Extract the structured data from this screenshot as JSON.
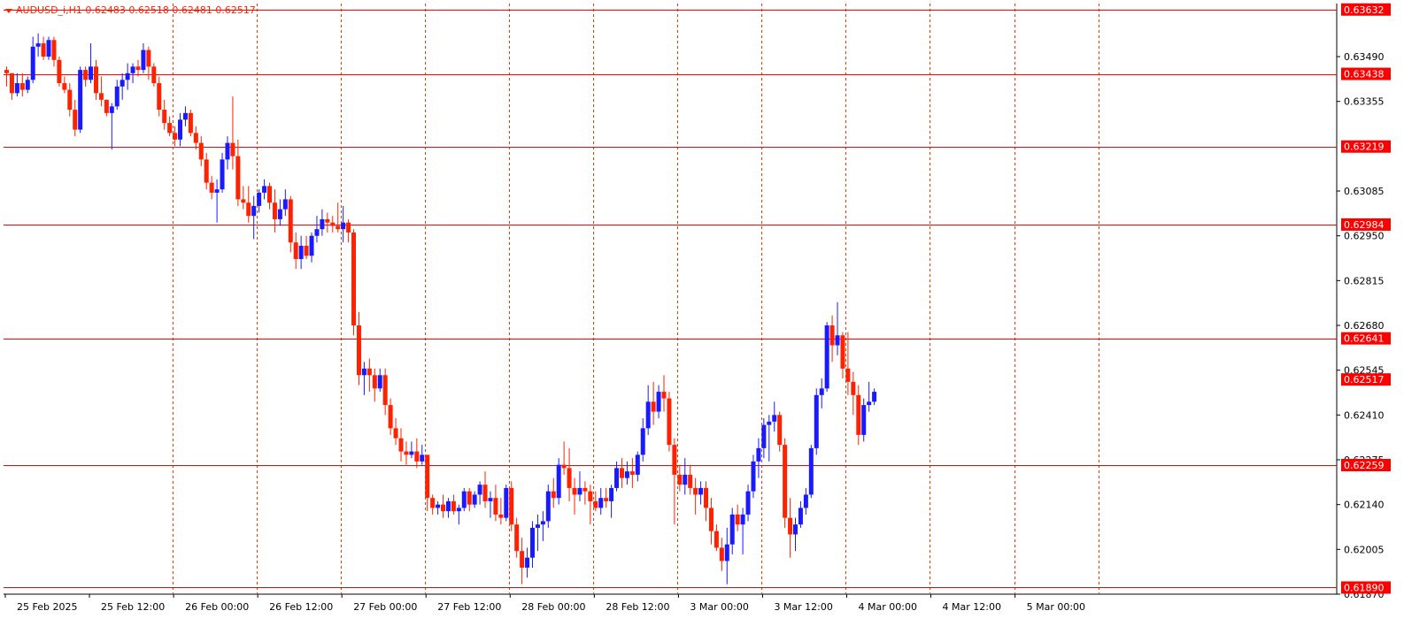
{
  "header": {
    "symbol_info": "AUDUSD_i,H1  0.62483 0.62518 0.62481 0.62517"
  },
  "colors": {
    "bull": "#1a1aff",
    "bear": "#ff2200",
    "hline": "#ff0000",
    "vgrid": "#ff3300",
    "axis": "#000000",
    "price_tag_bg": "#ff0000",
    "price_tag_text": "#ffffff"
  },
  "chart_data": {
    "type": "candlestick",
    "timeframe": "H1",
    "symbol": "AUDUSD_i",
    "ylim": [
      0.6187,
      0.6365
    ],
    "y_ticks": [
      "0.63490",
      "0.63355",
      "0.63085",
      "0.62950",
      "0.62815",
      "0.62680",
      "0.62545",
      "0.62410",
      "0.62275",
      "0.62140",
      "0.62005",
      "0.61870"
    ],
    "x_tick_labels": [
      "25 Feb 2025",
      "25 Feb 12:00",
      "26 Feb 00:00",
      "26 Feb 12:00",
      "27 Feb 00:00",
      "27 Feb 12:00",
      "28 Feb 00:00",
      "28 Feb 12:00",
      "3 Mar 00:00",
      "3 Mar 12:00",
      "4 Mar 00:00",
      "4 Mar 12:00",
      "5 Mar 00:00"
    ],
    "vertical_separators_after_label_index": [
      1,
      2,
      3,
      4,
      5,
      6,
      7,
      8,
      9,
      10,
      11,
      12
    ],
    "horizontal_levels": [
      "0.63632",
      "0.63438",
      "0.63219",
      "0.62984",
      "0.62641",
      "0.62259",
      "0.61890"
    ],
    "current_price": "0.62517",
    "candles": [
      [
        0.6345,
        0.6346,
        0.634,
        0.6344
      ],
      [
        0.6344,
        0.6344,
        0.6336,
        0.6338
      ],
      [
        0.6338,
        0.6344,
        0.6337,
        0.6341
      ],
      [
        0.6341,
        0.6344,
        0.6337,
        0.6339
      ],
      [
        0.6339,
        0.6343,
        0.6338,
        0.6342
      ],
      [
        0.6342,
        0.6355,
        0.6341,
        0.6352
      ],
      [
        0.6352,
        0.6356,
        0.6349,
        0.6353
      ],
      [
        0.6353,
        0.6355,
        0.6348,
        0.6349
      ],
      [
        0.6349,
        0.6355,
        0.6348,
        0.6354
      ],
      [
        0.6354,
        0.6355,
        0.6346,
        0.6348
      ],
      [
        0.6348,
        0.6349,
        0.634,
        0.6341
      ],
      [
        0.6341,
        0.6343,
        0.6338,
        0.6339
      ],
      [
        0.6339,
        0.6341,
        0.6331,
        0.6333
      ],
      [
        0.6333,
        0.6336,
        0.6325,
        0.6327
      ],
      [
        0.6327,
        0.6346,
        0.6326,
        0.6345
      ],
      [
        0.6345,
        0.6346,
        0.634,
        0.6342
      ],
      [
        0.6342,
        0.6353,
        0.6341,
        0.6346
      ],
      [
        0.6346,
        0.6348,
        0.6336,
        0.6338
      ],
      [
        0.6338,
        0.6343,
        0.6334,
        0.6336
      ],
      [
        0.6336,
        0.6336,
        0.6331,
        0.6332
      ],
      [
        0.6332,
        0.6335,
        0.6321,
        0.6334
      ],
      [
        0.6334,
        0.6342,
        0.6333,
        0.634
      ],
      [
        0.634,
        0.6344,
        0.6336,
        0.6342
      ],
      [
        0.6342,
        0.6347,
        0.6339,
        0.6344
      ],
      [
        0.6344,
        0.6347,
        0.6341,
        0.6346
      ],
      [
        0.6346,
        0.6348,
        0.6343,
        0.6345
      ],
      [
        0.6345,
        0.6353,
        0.6344,
        0.6351
      ],
      [
        0.6351,
        0.6352,
        0.6342,
        0.6346
      ],
      [
        0.6346,
        0.6347,
        0.634,
        0.6341
      ],
      [
        0.6341,
        0.6343,
        0.6331,
        0.6333
      ],
      [
        0.6333,
        0.6336,
        0.6327,
        0.6329
      ],
      [
        0.6329,
        0.6331,
        0.6325,
        0.6326
      ],
      [
        0.6326,
        0.6328,
        0.6322,
        0.6324
      ],
      [
        0.6324,
        0.6332,
        0.6322,
        0.633
      ],
      [
        0.633,
        0.6334,
        0.6328,
        0.6332
      ],
      [
        0.6332,
        0.6333,
        0.6325,
        0.6326
      ],
      [
        0.6326,
        0.6328,
        0.6321,
        0.6323
      ],
      [
        0.6323,
        0.6325,
        0.6316,
        0.6318
      ],
      [
        0.6318,
        0.632,
        0.6309,
        0.6311
      ],
      [
        0.6311,
        0.6313,
        0.6306,
        0.6308
      ],
      [
        0.6308,
        0.6312,
        0.6299,
        0.6309
      ],
      [
        0.6309,
        0.632,
        0.6308,
        0.6318
      ],
      [
        0.6318,
        0.6325,
        0.6315,
        0.6323
      ],
      [
        0.6323,
        0.6337,
        0.6315,
        0.6319
      ],
      [
        0.6319,
        0.6324,
        0.6304,
        0.6306
      ],
      [
        0.6306,
        0.631,
        0.6303,
        0.6305
      ],
      [
        0.6305,
        0.631,
        0.6299,
        0.6301
      ],
      [
        0.6301,
        0.6307,
        0.6294,
        0.6304
      ],
      [
        0.6304,
        0.6309,
        0.6302,
        0.6308
      ],
      [
        0.6308,
        0.6312,
        0.6306,
        0.631
      ],
      [
        0.631,
        0.6311,
        0.6303,
        0.6305
      ],
      [
        0.6305,
        0.6309,
        0.6296,
        0.63
      ],
      [
        0.63,
        0.6306,
        0.6298,
        0.6303
      ],
      [
        0.6303,
        0.6309,
        0.6301,
        0.6306
      ],
      [
        0.6306,
        0.6307,
        0.629,
        0.6293
      ],
      [
        0.6293,
        0.6296,
        0.6285,
        0.6288
      ],
      [
        0.6288,
        0.6295,
        0.6285,
        0.6292
      ],
      [
        0.6292,
        0.6295,
        0.6288,
        0.6289
      ],
      [
        0.6289,
        0.6296,
        0.6287,
        0.6295
      ],
      [
        0.6295,
        0.6301,
        0.6293,
        0.6297
      ],
      [
        0.6297,
        0.6303,
        0.6295,
        0.63
      ],
      [
        0.63,
        0.6302,
        0.6296,
        0.6299
      ],
      [
        0.6299,
        0.6301,
        0.6296,
        0.6298
      ],
      [
        0.6298,
        0.6305,
        0.6296,
        0.6297
      ],
      [
        0.6297,
        0.6304,
        0.6293,
        0.6299
      ],
      [
        0.6299,
        0.63,
        0.6293,
        0.6296
      ],
      [
        0.6296,
        0.6297,
        0.6265,
        0.6268
      ],
      [
        0.6268,
        0.6272,
        0.625,
        0.6253
      ],
      [
        0.6253,
        0.6257,
        0.6247,
        0.6255
      ],
      [
        0.6255,
        0.6258,
        0.6248,
        0.6253
      ],
      [
        0.6253,
        0.6255,
        0.6245,
        0.6249
      ],
      [
        0.6249,
        0.6255,
        0.6248,
        0.6253
      ],
      [
        0.6253,
        0.6255,
        0.6241,
        0.6244
      ],
      [
        0.6244,
        0.6246,
        0.6235,
        0.6237
      ],
      [
        0.6237,
        0.624,
        0.6232,
        0.6234
      ],
      [
        0.6234,
        0.6237,
        0.6227,
        0.623
      ],
      [
        0.623,
        0.6233,
        0.6226,
        0.6229
      ],
      [
        0.6229,
        0.6233,
        0.6228,
        0.623
      ],
      [
        0.623,
        0.6234,
        0.6225,
        0.6227
      ],
      [
        0.6227,
        0.6232,
        0.6226,
        0.6229
      ],
      [
        0.6229,
        0.6229,
        0.6212,
        0.6216
      ],
      [
        0.6216,
        0.6217,
        0.6211,
        0.6213
      ],
      [
        0.6213,
        0.6215,
        0.6211,
        0.6214
      ],
      [
        0.6214,
        0.6217,
        0.621,
        0.6212
      ],
      [
        0.6212,
        0.6216,
        0.621,
        0.6215
      ],
      [
        0.6215,
        0.6217,
        0.6211,
        0.6212
      ],
      [
        0.6212,
        0.6214,
        0.6208,
        0.6213
      ],
      [
        0.6213,
        0.6219,
        0.6212,
        0.6218
      ],
      [
        0.6218,
        0.6219,
        0.6212,
        0.6214
      ],
      [
        0.6214,
        0.6218,
        0.6213,
        0.6217
      ],
      [
        0.6217,
        0.6221,
        0.6214,
        0.622
      ],
      [
        0.622,
        0.6224,
        0.6213,
        0.6215
      ],
      [
        0.6215,
        0.6218,
        0.621,
        0.6216
      ],
      [
        0.6216,
        0.622,
        0.6209,
        0.6211
      ],
      [
        0.6211,
        0.6216,
        0.6208,
        0.621
      ],
      [
        0.621,
        0.622,
        0.6209,
        0.6219
      ],
      [
        0.6219,
        0.6221,
        0.6206,
        0.6208
      ],
      [
        0.6208,
        0.621,
        0.6198,
        0.62
      ],
      [
        0.62,
        0.6204,
        0.619,
        0.6195
      ],
      [
        0.6195,
        0.6201,
        0.6192,
        0.6198
      ],
      [
        0.6198,
        0.6209,
        0.6195,
        0.6207
      ],
      [
        0.6207,
        0.6211,
        0.62,
        0.6208
      ],
      [
        0.6208,
        0.6212,
        0.6203,
        0.6209
      ],
      [
        0.6209,
        0.622,
        0.6207,
        0.6218
      ],
      [
        0.6218,
        0.6222,
        0.6213,
        0.6216
      ],
      [
        0.6216,
        0.6228,
        0.6214,
        0.6226
      ],
      [
        0.6226,
        0.6233,
        0.6223,
        0.6225
      ],
      [
        0.6225,
        0.6231,
        0.6215,
        0.6219
      ],
      [
        0.6219,
        0.6222,
        0.6211,
        0.6217
      ],
      [
        0.6217,
        0.6224,
        0.6215,
        0.6219
      ],
      [
        0.6219,
        0.6221,
        0.6214,
        0.6218
      ],
      [
        0.6218,
        0.622,
        0.6208,
        0.6215
      ],
      [
        0.6215,
        0.6218,
        0.6212,
        0.6213
      ],
      [
        0.6213,
        0.6219,
        0.6211,
        0.6216
      ],
      [
        0.6216,
        0.6219,
        0.6213,
        0.6215
      ],
      [
        0.6215,
        0.622,
        0.621,
        0.6219
      ],
      [
        0.6219,
        0.6227,
        0.6218,
        0.6225
      ],
      [
        0.6225,
        0.6228,
        0.6219,
        0.6222
      ],
      [
        0.6222,
        0.6227,
        0.622,
        0.6224
      ],
      [
        0.6224,
        0.6228,
        0.6219,
        0.6223
      ],
      [
        0.6223,
        0.623,
        0.6221,
        0.6229
      ],
      [
        0.6229,
        0.624,
        0.6227,
        0.6237
      ],
      [
        0.6237,
        0.625,
        0.6235,
        0.6245
      ],
      [
        0.6245,
        0.6251,
        0.6238,
        0.6242
      ],
      [
        0.6242,
        0.625,
        0.624,
        0.6248
      ],
      [
        0.6248,
        0.6253,
        0.6242,
        0.6246
      ],
      [
        0.6246,
        0.6248,
        0.623,
        0.6232
      ],
      [
        0.6232,
        0.6234,
        0.6208,
        0.6223
      ],
      [
        0.6223,
        0.6226,
        0.6218,
        0.622
      ],
      [
        0.622,
        0.6228,
        0.6217,
        0.6223
      ],
      [
        0.6223,
        0.6226,
        0.6217,
        0.6219
      ],
      [
        0.6219,
        0.6222,
        0.6211,
        0.6217
      ],
      [
        0.6217,
        0.6221,
        0.6214,
        0.6219
      ],
      [
        0.6219,
        0.6221,
        0.6209,
        0.6213
      ],
      [
        0.6213,
        0.6216,
        0.6202,
        0.6206
      ],
      [
        0.6206,
        0.6208,
        0.62,
        0.6201
      ],
      [
        0.6201,
        0.6204,
        0.6194,
        0.6197
      ],
      [
        0.6197,
        0.6207,
        0.619,
        0.6202
      ],
      [
        0.6202,
        0.6213,
        0.6199,
        0.6211
      ],
      [
        0.6211,
        0.6214,
        0.6206,
        0.6208
      ],
      [
        0.6208,
        0.6213,
        0.6199,
        0.6211
      ],
      [
        0.6211,
        0.622,
        0.6209,
        0.6218
      ],
      [
        0.6218,
        0.6229,
        0.6216,
        0.6227
      ],
      [
        0.6227,
        0.6234,
        0.6222,
        0.6231
      ],
      [
        0.6231,
        0.624,
        0.6228,
        0.6238
      ],
      [
        0.6238,
        0.6241,
        0.6227,
        0.6239
      ],
      [
        0.6239,
        0.6245,
        0.6236,
        0.6241
      ],
      [
        0.6241,
        0.6242,
        0.623,
        0.6232
      ],
      [
        0.6232,
        0.6234,
        0.6207,
        0.621
      ],
      [
        0.621,
        0.6216,
        0.6198,
        0.6205
      ],
      [
        0.6205,
        0.621,
        0.62,
        0.6208
      ],
      [
        0.6208,
        0.6215,
        0.6207,
        0.6213
      ],
      [
        0.6213,
        0.6219,
        0.6211,
        0.6217
      ],
      [
        0.6217,
        0.6232,
        0.6216,
        0.6231
      ],
      [
        0.6231,
        0.6249,
        0.6229,
        0.6247
      ],
      [
        0.6247,
        0.6252,
        0.6243,
        0.6249
      ],
      [
        0.6249,
        0.6269,
        0.6248,
        0.6268
      ],
      [
        0.6268,
        0.6271,
        0.6257,
        0.6262
      ],
      [
        0.6262,
        0.6275,
        0.6259,
        0.6265
      ],
      [
        0.6265,
        0.6266,
        0.6252,
        0.6255
      ],
      [
        0.6255,
        0.6266,
        0.6247,
        0.6251
      ],
      [
        0.6251,
        0.6254,
        0.6241,
        0.6247
      ],
      [
        0.6247,
        0.625,
        0.6232,
        0.6235
      ],
      [
        0.6235,
        0.6246,
        0.6233,
        0.6244
      ],
      [
        0.6244,
        0.6251,
        0.6242,
        0.6245
      ],
      [
        0.6245,
        0.6249,
        0.6244,
        0.6248
      ]
    ]
  }
}
